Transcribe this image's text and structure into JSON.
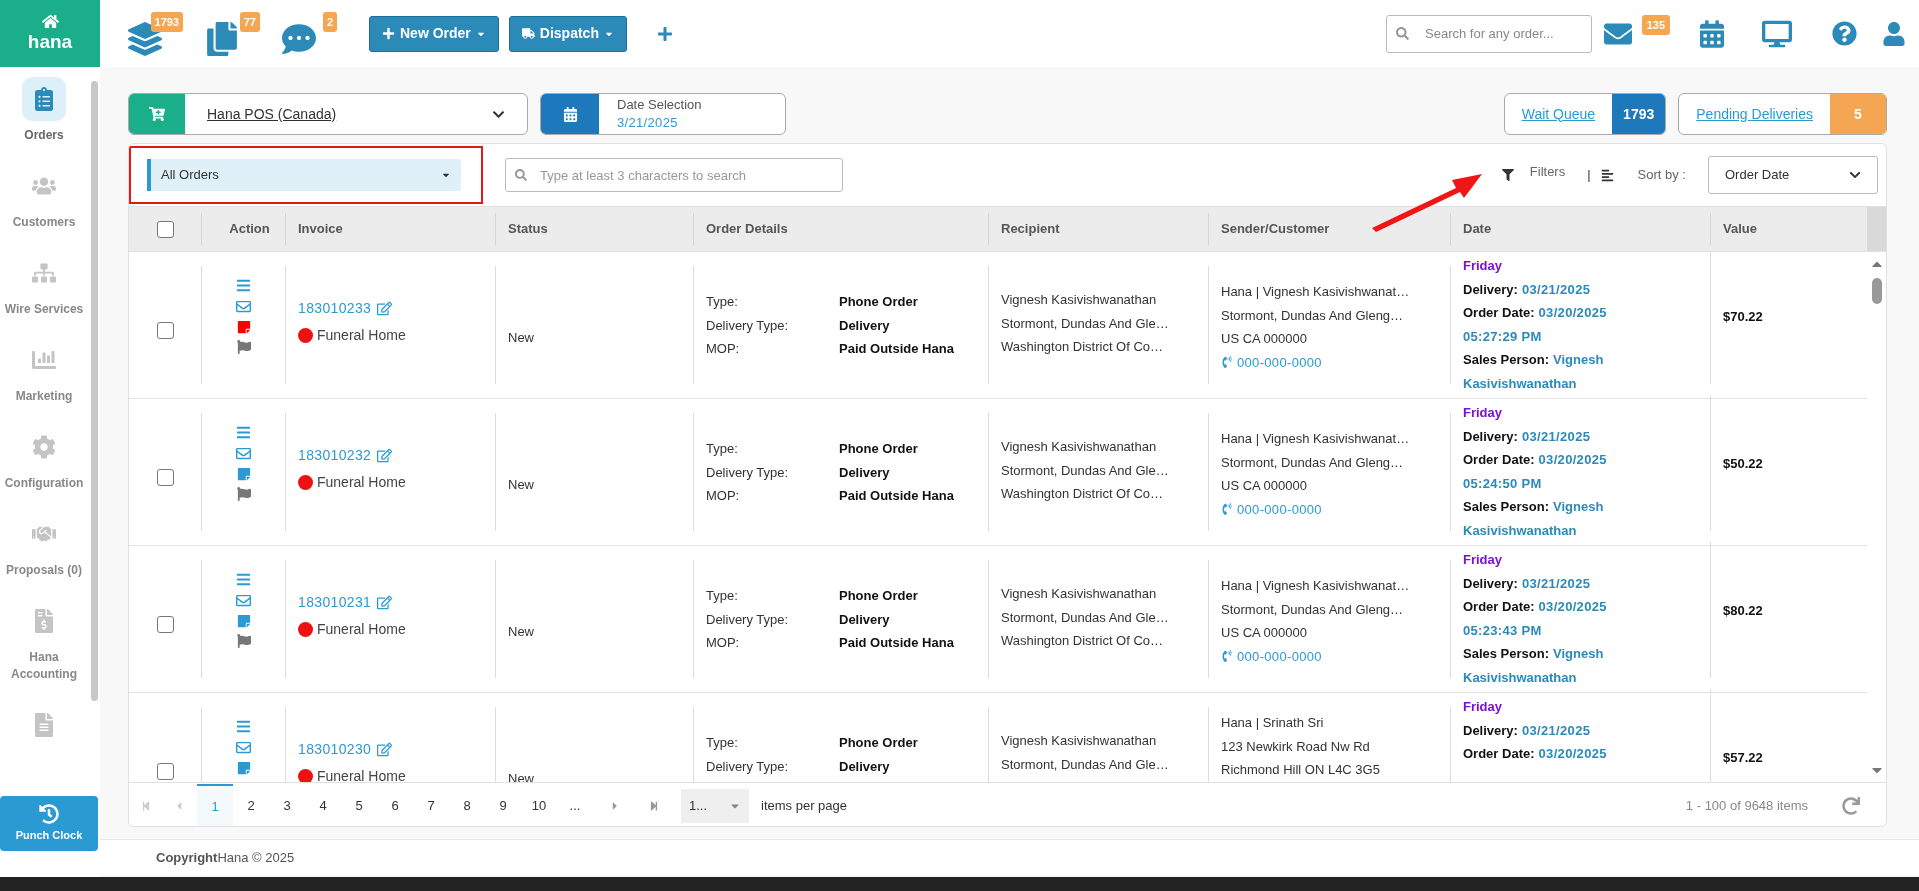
{
  "logo": {
    "text": "hana"
  },
  "top_bar": {
    "counters": [
      {
        "kind": "stack",
        "badge": "1793"
      },
      {
        "kind": "copy",
        "badge": "77"
      },
      {
        "kind": "chat",
        "badge": "2"
      }
    ],
    "buttons": [
      {
        "kind": "plus",
        "label": "New Order"
      },
      {
        "kind": "truck",
        "label": "Dispatch"
      }
    ],
    "search": {
      "placeholder": "Search for any order..."
    },
    "mail_badge": "135"
  },
  "sidebar": {
    "items": [
      {
        "kind": "orders",
        "label": "Orders",
        "selected": true
      },
      {
        "kind": "customers",
        "label": "Customers",
        "selected": false
      },
      {
        "kind": "wire",
        "label": "Wire Services",
        "selected": false
      },
      {
        "kind": "marketing",
        "label": "Marketing",
        "selected": false
      },
      {
        "kind": "config",
        "label": "Configuration",
        "selected": false
      },
      {
        "kind": "proposals",
        "label": "Proposals (0)",
        "selected": false
      },
      {
        "kind": "accounting",
        "label": "Hana Accounting",
        "selected": false
      },
      {
        "kind": "report",
        "selected": false
      }
    ],
    "punch_clock": "Punch Clock"
  },
  "store_selector": {
    "value": "Hana POS (Canada)"
  },
  "date_selection": {
    "label": "Date Selection",
    "value": "3/21/2025"
  },
  "wait_queue": {
    "label": "Wait Queue",
    "count": "1793"
  },
  "pending_deliveries": {
    "label": "Pending Deliveries",
    "count": "5"
  },
  "toolbar": {
    "order_filter": "All Orders",
    "search": {
      "placeholder": "Type at least 3 characters to search"
    },
    "filters": "Filters",
    "separator": "|",
    "sort_label": "Sort by :",
    "sort_value": "Order Date"
  },
  "table": {
    "columns": [
      "Action",
      "Invoice",
      "Status",
      "Order Details",
      "Recipient",
      "Sender/Customer",
      "Date",
      "Value"
    ],
    "header_checked": false,
    "rows": [
      {
        "checked": false,
        "flag": true,
        "note": {
          "color": "#ff0000"
        },
        "invoice": "183010233",
        "category": {
          "label": "Funeral Home",
          "color": "#ee1111"
        },
        "status": "New",
        "details": [
          [
            "Type:",
            "Phone Order"
          ],
          [
            "Delivery Type:",
            "Delivery"
          ],
          [
            "MOP:",
            "Paid Outside Hana"
          ]
        ],
        "recipient": [
          "Vignesh Kasivishwanathan",
          "Stormont, Dundas And Gle…",
          "Washington District Of Co…"
        ],
        "sender": [
          "Hana | Vignesh Kasivishwanat…",
          "Stormont, Dundas And Gleng…",
          "US CA 000000"
        ],
        "phone": "000-000-0000",
        "date": {
          "day": "Friday",
          "delivery_label": "Delivery:",
          "delivery": "03/21/2025",
          "order_label": "Order Date:",
          "order": "03/20/2025",
          "time": "05:27:29 PM",
          "sales_label": "Sales Person:",
          "sales": "Vignesh",
          "sales_2": "Kasivishwanathan"
        },
        "value": "$70.22"
      },
      {
        "checked": false,
        "flag": true,
        "note": {
          "color": "#2b9ad3"
        },
        "invoice": "183010232",
        "category": {
          "label": "Funeral Home",
          "color": "#ee1111"
        },
        "status": "New",
        "details": [
          [
            "Type:",
            "Phone Order"
          ],
          [
            "Delivery Type:",
            "Delivery"
          ],
          [
            "MOP:",
            "Paid Outside Hana"
          ]
        ],
        "recipient": [
          "Vignesh Kasivishwanathan",
          "Stormont, Dundas And Gle…",
          "Washington District Of Co…"
        ],
        "sender": [
          "Hana | Vignesh Kasivishwanat…",
          "Stormont, Dundas And Gleng…",
          "US CA 000000"
        ],
        "phone": "000-000-0000",
        "date": {
          "day": "Friday",
          "delivery_label": "Delivery:",
          "delivery": "03/21/2025",
          "order_label": "Order Date:",
          "order": "03/20/2025",
          "time": "05:24:50 PM",
          "sales_label": "Sales Person:",
          "sales": "Vignesh",
          "sales_2": "Kasivishwanathan"
        },
        "value": "$50.22"
      },
      {
        "checked": false,
        "flag": true,
        "note": {
          "color": "#2b9ad3"
        },
        "invoice": "183010231",
        "category": {
          "label": "Funeral Home",
          "color": "#ee1111"
        },
        "status": "New",
        "details": [
          [
            "Type:",
            "Phone Order"
          ],
          [
            "Delivery Type:",
            "Delivery"
          ],
          [
            "MOP:",
            "Paid Outside Hana"
          ]
        ],
        "recipient": [
          "Vignesh Kasivishwanathan",
          "Stormont, Dundas And Gle…",
          "Washington District Of Co…"
        ],
        "sender": [
          "Hana | Vignesh Kasivishwanat…",
          "Stormont, Dundas And Gleng…",
          "US CA 000000"
        ],
        "phone": "000-000-0000",
        "date": {
          "day": "Friday",
          "delivery_label": "Delivery:",
          "delivery": "03/21/2025",
          "order_label": "Order Date:",
          "order": "03/20/2025",
          "time": "05:23:43 PM",
          "sales_label": "Sales Person:",
          "sales": "Vignesh",
          "sales_2": "Kasivishwanathan"
        },
        "value": "$80.22"
      },
      {
        "checked": false,
        "note": {
          "color": "#2b9ad3"
        },
        "invoice": "183010230",
        "category": {
          "label": "Funeral Home",
          "color": "#ee1111"
        },
        "status": "New",
        "details": [
          [
            "Type:",
            "Phone Order"
          ],
          [
            "Delivery Type:",
            "Delivery"
          ]
        ],
        "recipient": [
          "Vignesh Kasivishwanathan",
          "Stormont, Dundas And Gle…"
        ],
        "sender": [
          "Hana | Srinath Sri",
          "123 Newkirk Road Nw Rd",
          "Richmond Hill ON L4C 3G5"
        ],
        "date": {
          "day": "Friday",
          "delivery_label": "Delivery:",
          "delivery": "03/21/2025",
          "order_label": "Order Date:",
          "order": "03/20/2025"
        },
        "value": "$57.22"
      }
    ]
  },
  "pagination": {
    "pages": [
      {
        "label": "1",
        "selected": true
      },
      {
        "label": "2",
        "selected": false
      },
      {
        "label": "3",
        "selected": false
      },
      {
        "label": "4",
        "selected": false
      },
      {
        "label": "5",
        "selected": false
      },
      {
        "label": "6",
        "selected": false
      },
      {
        "label": "7",
        "selected": false
      },
      {
        "label": "8",
        "selected": false
      },
      {
        "label": "9",
        "selected": false
      },
      {
        "label": "10",
        "selected": false
      },
      {
        "label": "...",
        "selected": false
      }
    ],
    "page_size": "1...",
    "page_size_label": "items per page",
    "summary": "1 - 100 of 9648 items"
  },
  "footer": "**Copyright**Hana © 2025"
}
